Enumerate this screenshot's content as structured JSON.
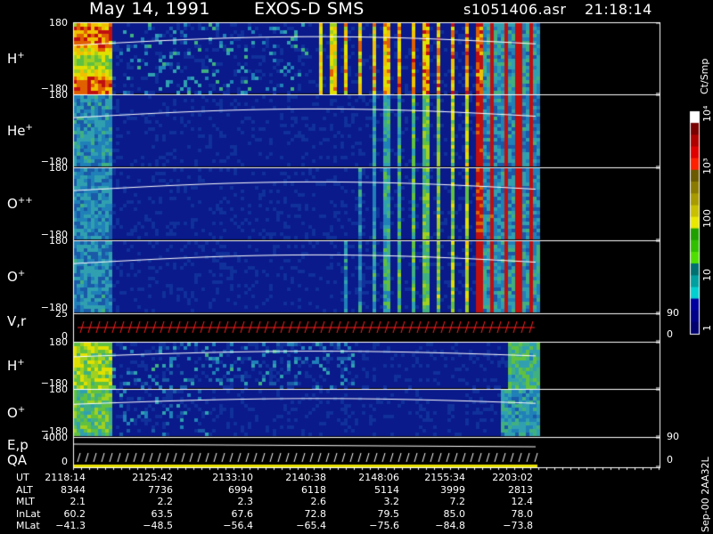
{
  "header": {
    "date": "May 14, 1991",
    "instrument": "EXOS-D SMS",
    "file": "s1051406.asr",
    "time": "21:18:14"
  },
  "panels": [
    {
      "label": "H",
      "sup": "+",
      "ytop": "180",
      "ybot": "−180",
      "kind": "spec"
    },
    {
      "label": "He",
      "sup": "+",
      "ytop": "180",
      "ybot": "−180",
      "kind": "spec"
    },
    {
      "label": "O",
      "sup": "++",
      "ytop": "180",
      "ybot": "−180",
      "kind": "spec"
    },
    {
      "label": "O",
      "sup": "+",
      "ytop": "180",
      "ybot": "−180",
      "kind": "spec"
    },
    {
      "label": "V,r",
      "sup": "",
      "ytop": "25",
      "ybot": "0",
      "rtop": "90",
      "rbot": "0",
      "kind": "vr"
    },
    {
      "label": "H",
      "sup": "+",
      "ytop": "180",
      "ybot": "−180",
      "kind": "spec"
    },
    {
      "label": "O",
      "sup": "+",
      "ytop": "180",
      "ybot": "−180",
      "kind": "spec"
    },
    {
      "label": "E,p",
      "label2": "QA",
      "sup": "",
      "ytop": "4000",
      "ybot": "0",
      "rtop": "90",
      "rbot": "0",
      "kind": "ep"
    }
  ],
  "colorbar": {
    "unit": "Ct/Smp",
    "ticks": [
      "10⁴",
      "10³",
      "100",
      "10",
      "1"
    ],
    "colors": [
      "#ffffff",
      "#7a0000",
      "#b00000",
      "#e00000",
      "#ff2000",
      "#6b5a00",
      "#8a7a00",
      "#a89a00",
      "#c8c000",
      "#e8e800",
      "#20a000",
      "#30c000",
      "#50e000",
      "#007070",
      "#00a0a0",
      "#00d0d0",
      "#0000a0",
      "#00008a",
      "#000070"
    ]
  },
  "footer_id": "Sep-00 2AA32L",
  "ephemeris": {
    "rows": [
      {
        "label": "UT",
        "values": [
          "2118:14",
          "2125:42",
          "2133:10",
          "2140:38",
          "2148:06",
          "2155:34",
          "2203:02"
        ]
      },
      {
        "label": "ALT",
        "values": [
          "8344",
          "7736",
          "6994",
          "6118",
          "5114",
          "3999",
          "2813"
        ]
      },
      {
        "label": "MLT",
        "values": [
          "2.1",
          "2.2",
          "2.3",
          "2.6",
          "3.2",
          "7.2",
          "12.4"
        ]
      },
      {
        "label": "InLat",
        "values": [
          "60.2",
          "63.5",
          "67.6",
          "72.8",
          "79.5",
          "85.0",
          "78.0"
        ]
      },
      {
        "label": "MLat",
        "values": [
          "−41.3",
          "−48.5",
          "−56.4",
          "−65.4",
          "−75.6",
          "−84.8",
          "−73.8"
        ]
      }
    ]
  },
  "chart_data": {
    "type": "heatmap",
    "title": "May 14, 1991   EXOS-D SMS",
    "x": [
      "2118:14",
      "2125:42",
      "2133:10",
      "2140:38",
      "2148:06",
      "2155:34",
      "2203:02"
    ],
    "series": [
      {
        "name": "H+",
        "ylim": [
          -180,
          180
        ]
      },
      {
        "name": "He+",
        "ylim": [
          -180,
          180
        ]
      },
      {
        "name": "O++",
        "ylim": [
          -180,
          180
        ]
      },
      {
        "name": "O+",
        "ylim": [
          -180,
          180
        ]
      },
      {
        "name": "V,r",
        "ylim": [
          0,
          25
        ]
      },
      {
        "name": "H+",
        "ylim": [
          -180,
          180
        ]
      },
      {
        "name": "O+",
        "ylim": [
          -180,
          180
        ]
      },
      {
        "name": "E,p",
        "ylim": [
          0,
          4000
        ]
      }
    ],
    "colorscale": {
      "label": "Ct/Smp",
      "range": [
        1,
        10000
      ],
      "scale": "log"
    }
  }
}
